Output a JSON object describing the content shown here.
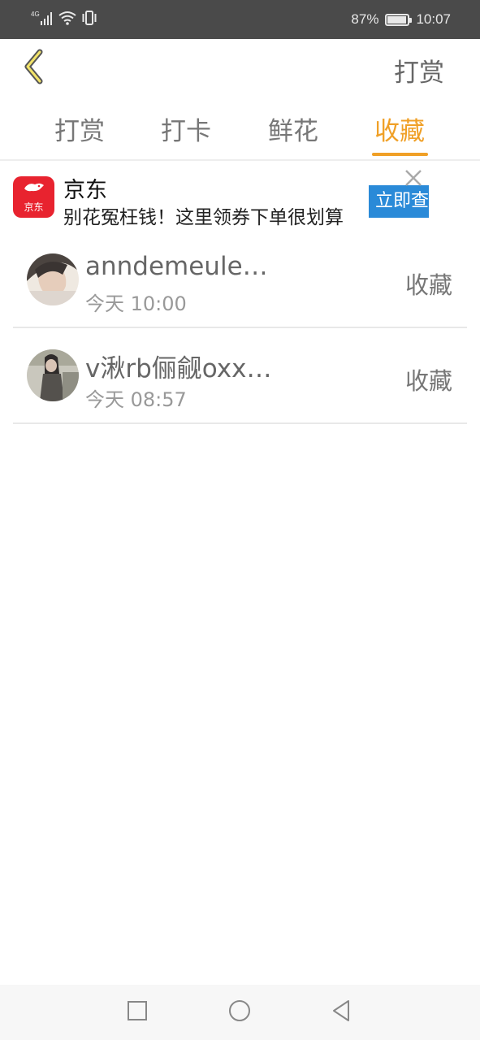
{
  "status_bar": {
    "network": "4G",
    "battery": "87%",
    "battery_level": 0.87,
    "time": "10:07"
  },
  "header": {
    "back_icon": "chevron-left-icon",
    "action_label": "打赏"
  },
  "tabs": [
    {
      "label": "打赏",
      "active": false
    },
    {
      "label": "打卡",
      "active": false
    },
    {
      "label": "鲜花",
      "active": false
    },
    {
      "label": "收藏",
      "active": true
    }
  ],
  "ad": {
    "logo_text": "京东",
    "title": "京东",
    "description": "别花冤枉钱！这里领券下单很划算",
    "button_label": "立即查看",
    "close_icon": "close-icon"
  },
  "list": [
    {
      "name": "anndemeulepeester",
      "time": "今天 10:00",
      "action": "收藏"
    },
    {
      "name": "v湫rb俪觎oxxxxxx",
      "time": "今天 08:57",
      "action": "收藏"
    }
  ],
  "colors": {
    "accent": "#f0a027",
    "status_bar_bg": "#4a4a4a",
    "ad_button": "#2a8ad8",
    "ad_logo": "#e8232f"
  }
}
